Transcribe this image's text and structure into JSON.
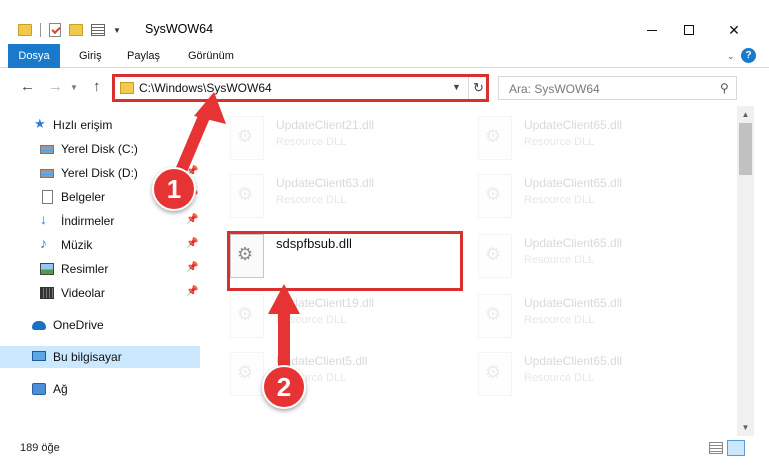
{
  "window": {
    "title": "SysWOW64",
    "controls": {
      "minimize": "",
      "maximize": "",
      "close": "✕"
    }
  },
  "ribbon": {
    "tabs": [
      "Dosya",
      "Giriş",
      "Paylaş",
      "Görünüm"
    ],
    "help": "?"
  },
  "address": {
    "path": "C:\\Windows\\SysWOW64",
    "search_placeholder": "Ara: SysWOW64"
  },
  "sidebar": {
    "quick_access": "Hızlı erişim",
    "items": [
      {
        "label": "Yerel Disk (C:)",
        "icon": "drive-icon",
        "pinned": false
      },
      {
        "label": "Yerel Disk (D:)",
        "icon": "drive-icon",
        "pinned": true
      },
      {
        "label": "Belgeler",
        "icon": "documents-icon",
        "pinned": true
      },
      {
        "label": "İndirmeler",
        "icon": "download-icon",
        "pinned": true
      },
      {
        "label": "Müzik",
        "icon": "music-icon",
        "pinned": true
      },
      {
        "label": "Resimler",
        "icon": "pictures-icon",
        "pinned": true
      },
      {
        "label": "Videolar",
        "icon": "videos-icon",
        "pinned": true
      }
    ],
    "onedrive": "OneDrive",
    "this_pc": "Bu bilgisayar",
    "network": "Ağ"
  },
  "files": {
    "highlighted": {
      "name": "sdspfbsub.dll"
    },
    "left_column": [
      {
        "name": "UpdateClient21.dll",
        "type": "Resource DLL"
      },
      {
        "name": "UpdateClient63.dll",
        "type": "Resource DLL"
      },
      {
        "name": "UpdateClient19.dll",
        "type": "Resource DLL"
      },
      {
        "name": "UpdateClient5.dll",
        "type": "Resource DLL"
      }
    ],
    "right_column": [
      {
        "name": "UpdateClient65.dll",
        "type": "Resource DLL"
      },
      {
        "name": "UpdateClient65.dll",
        "type": "Resource DLL"
      },
      {
        "name": "UpdateClient65.dll",
        "type": "Resource DLL"
      },
      {
        "name": "UpdateClient65.dll",
        "type": "Resource DLL"
      },
      {
        "name": "UpdateClient65.dll",
        "type": "Resource DLL"
      }
    ]
  },
  "status": {
    "item_count": "189 öğe"
  },
  "annotations": {
    "step1": "1",
    "step2": "2",
    "color": "#e53433"
  }
}
